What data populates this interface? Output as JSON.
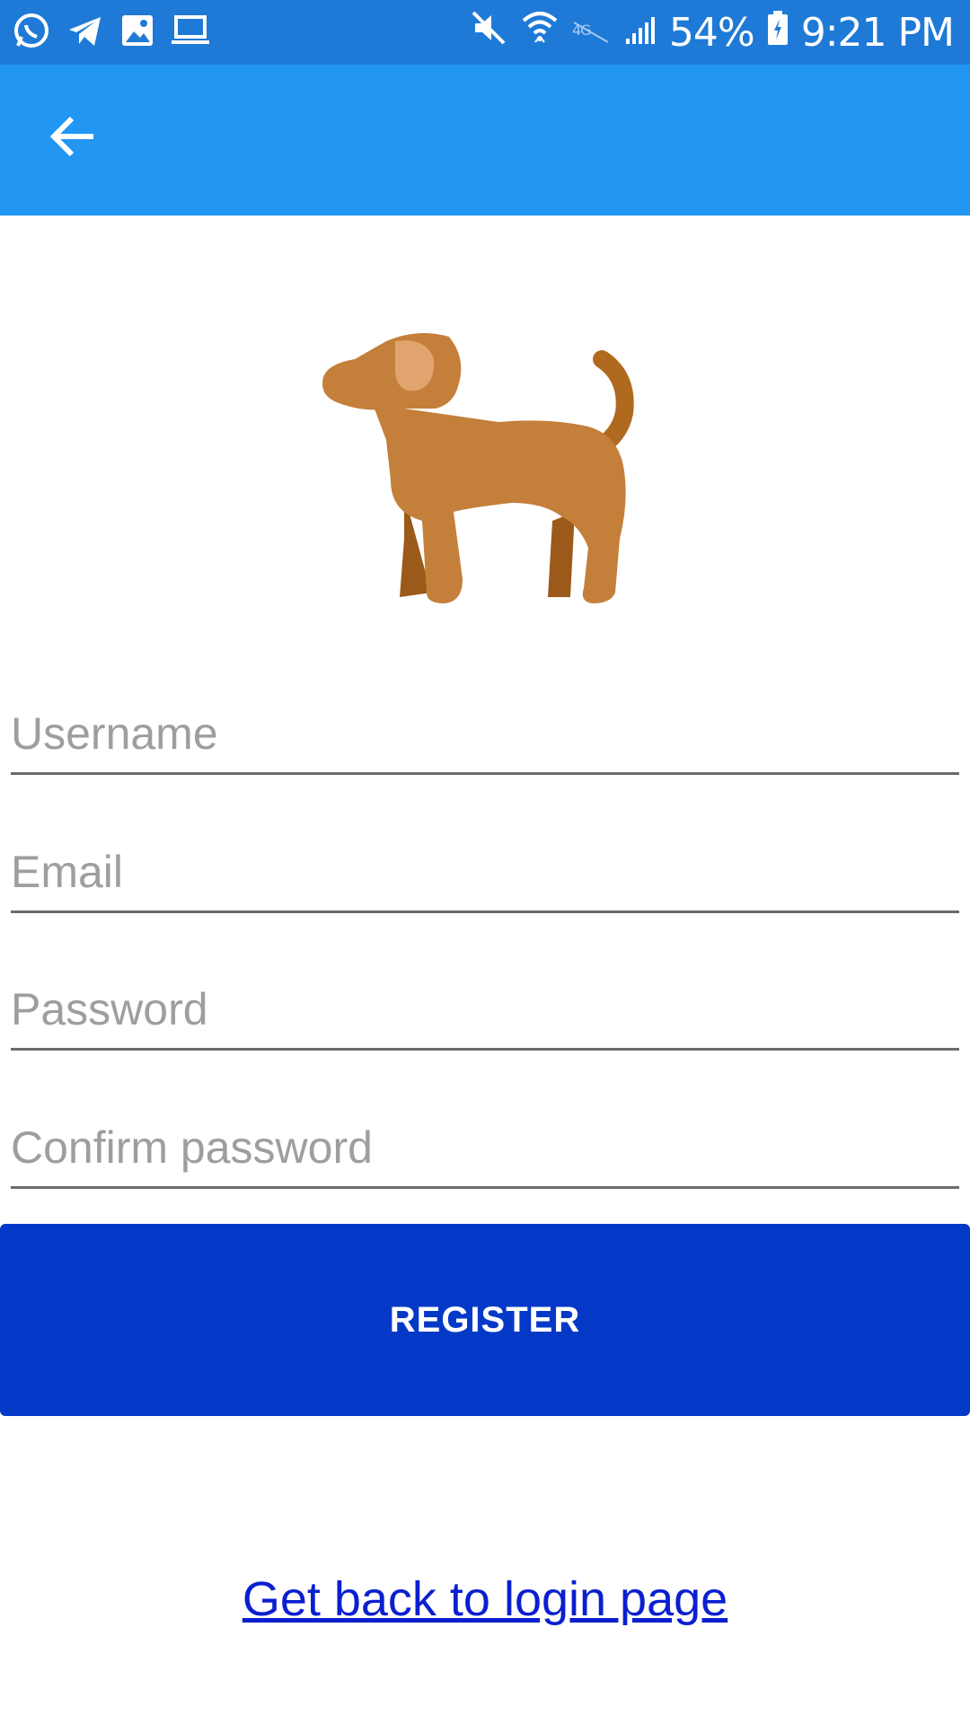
{
  "status_bar": {
    "battery": "54%",
    "time": "9:21 PM",
    "left_icons": [
      "whatsapp-icon",
      "telegram-icon",
      "image-icon",
      "laptop-icon"
    ],
    "right_icons": [
      "mute-icon",
      "wifi-icon",
      "lte-icon",
      "signal-icon",
      "battery-icon"
    ]
  },
  "app_bar": {
    "back_icon": "arrow-left-icon",
    "color": "#2196f3"
  },
  "logo": {
    "icon": "dog-icon"
  },
  "form": {
    "username": {
      "value": "",
      "placeholder": "Username"
    },
    "email": {
      "value": "",
      "placeholder": "Email"
    },
    "password": {
      "value": "",
      "placeholder": "Password"
    },
    "confirm_password": {
      "value": "",
      "placeholder": "Confirm password"
    }
  },
  "register_button": {
    "label": "REGISTER",
    "color": "#0439c8"
  },
  "login_link": {
    "label": "Get back to login page"
  },
  "colors": {
    "status_bar": "#1e7ad6",
    "link": "#0a1fd0",
    "underline": "#6b6b6b",
    "placeholder": "#9e9e9e"
  }
}
